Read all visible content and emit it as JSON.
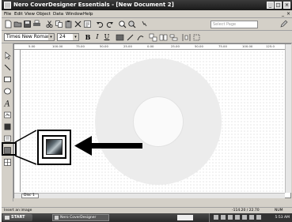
{
  "window": {
    "title": "Nero CoverDesigner Essentials - [New Document 2]",
    "minimize_glyph": "_",
    "maximize_glyph": "□",
    "close_glyph": "×"
  },
  "menu": {
    "items": [
      "File",
      "Edit",
      "View",
      "Object",
      "Data",
      "Window",
      "Help"
    ],
    "mdi_min": "_",
    "mdi_close": "×"
  },
  "toolbar": {
    "zoom_placeholder": "Select Page",
    "icons": [
      "new-icon",
      "open-icon",
      "save-icon",
      "print-icon",
      "cut-icon",
      "copy-icon",
      "paste-icon",
      "delete-icon",
      "properties-icon",
      "undo-icon",
      "redo-icon",
      "zoom-in-icon",
      "zoom-out-icon",
      "help-icon"
    ]
  },
  "textbar": {
    "font": "Times New Roman",
    "size": "24",
    "bold": "B",
    "italic": "I",
    "underline": "U"
  },
  "ruler": {
    "ticks": [
      "5.00",
      "100.00",
      "75.00",
      "50.00",
      "25.00",
      "0.00",
      "25.00",
      "50.00",
      "75.00",
      "100.00",
      "125.0"
    ]
  },
  "document": {
    "tab_label": "Disc 1"
  },
  "status": {
    "left": "Insert an image",
    "coords": "-114.20 / 22.70",
    "mode": "NUM"
  },
  "taskbar": {
    "start": "START",
    "app": "Nero CoverDesigner",
    "clock": "5:53 AM"
  },
  "colors": {
    "titlebar": "#2a2a2a",
    "chrome": "#d4d0c8",
    "disc": "#ececec",
    "callout": "#000000"
  }
}
